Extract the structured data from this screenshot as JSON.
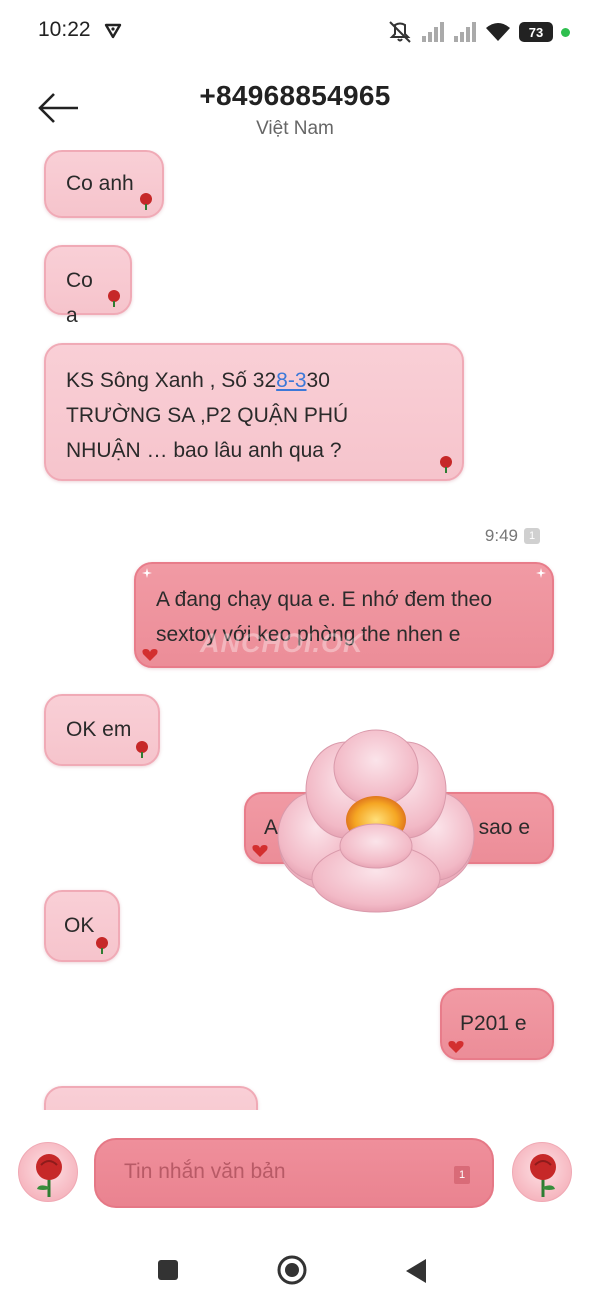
{
  "status_bar": {
    "time": "10:22",
    "battery": "73",
    "icons": [
      "shield-icon",
      "mute-icon",
      "signal-icon",
      "signal-icon",
      "wifi-icon",
      "battery-icon"
    ]
  },
  "header": {
    "phone_number": "+84968854965",
    "country": "Việt Nam",
    "back_icon": "arrow-left-icon"
  },
  "messages": [
    {
      "direction": "in",
      "text": "Co anh"
    },
    {
      "direction": "in",
      "text": "Co a"
    },
    {
      "direction": "in",
      "text_before": "KS Sông Xanh , Số 32",
      "link": "8-3",
      "text_after": "30",
      "line2": "TRƯỜNG SA ,P2 QUẬN PHÚ",
      "line3": "NHUẬN  … bao lâu anh qua ?"
    },
    {
      "direction": "out",
      "time": "9:49",
      "sim": "1",
      "line1": "A đang chạy qua e. E nhớ đem theo",
      "line2": "sextoy với keo phòng the nhen e"
    },
    {
      "direction": "in",
      "text": "OK em"
    },
    {
      "direction": "out",
      "text_start": "A",
      "text_end": "sao e"
    },
    {
      "direction": "in",
      "text": "OK"
    },
    {
      "direction": "out",
      "text": "P201 e"
    }
  ],
  "watermark": "ANCHOI.OK",
  "composer": {
    "placeholder": "Tin nhắn văn bản",
    "sim": "1"
  },
  "nav": [
    "recents-button",
    "home-button",
    "back-button"
  ],
  "colors": {
    "incoming_bubble": "#f8cad2",
    "outgoing_bubble": "#ee929d",
    "link": "#3b78d8"
  }
}
